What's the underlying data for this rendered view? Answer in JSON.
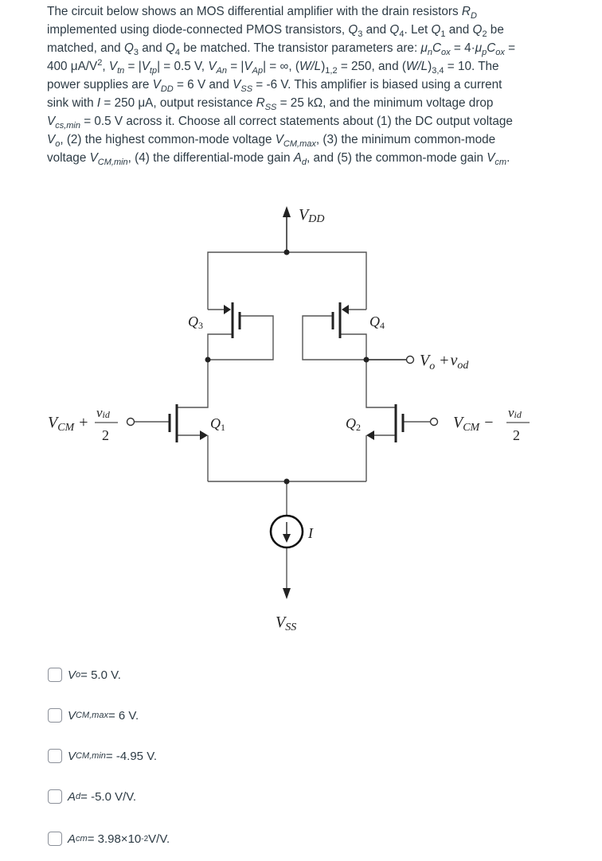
{
  "question": {
    "p1": "The circuit below shows an MOS differential amplifier with the drain resistors ",
    "RD": "R",
    "RD_sub": "D",
    "p2": " implemented using diode-connected PMOS transistors, ",
    "Q3": "Q",
    "Q3_sub": "3",
    "and": " and ",
    "Q4": "Q",
    "Q4_sub": "4",
    "p3": ". Let ",
    "Q1": "Q",
    "Q1_sub": "1",
    "Q2": "Q",
    "Q2_sub": "2",
    "p4": " be matched, and ",
    "p5": " be matched. The transistor parameters are: ",
    "mun": "μ",
    "mun_sub": "n",
    "Cox": "C",
    "Cox_sub": "ox",
    "p6": " = 4·",
    "mup": "μ",
    "mup_sub": "p",
    "p7": " = 400 μA/V",
    "sq": "2",
    "p8": ", ",
    "Vtn": "V",
    "Vtn_sub": "tn",
    "p9": " = |",
    "Vtp": "V",
    "Vtp_sub": "tp",
    "p10": "| = 0.5 V, ",
    "VAn": "V",
    "VAn_sub": "An",
    "VAp": "V",
    "VAp_sub": "Ap",
    "p11": "| = ∞, (",
    "WL": "W/L",
    "WL12_sub": "1,2",
    "p12": ") ",
    "p13": " = 250, and (",
    "WL34_sub": "3,4",
    "p14": " = 10. The power supplies are ",
    "VDD": "V",
    "VDD_sub": "DD",
    "p15": " = 6 V and ",
    "VSS": "V",
    "VSS_sub": "SS",
    "p16": " = -6 V. This amplifier is biased using a current sink with ",
    "I": "I",
    "p17": " = 250 μA, output resistance ",
    "RSS": "R",
    "RSS_sub": "SS",
    "p18": " = 25 kΩ, and the minimum voltage drop ",
    "Vcs": "V",
    "Vcs_sub": "cs,min",
    "p19": " = 0.5 V across it. Choose all correct statements about (1) the DC output voltage ",
    "Vo": "V",
    "Vo_sub": "o",
    "p20": ", (2) the highest common-mode voltage ",
    "VCMmax": "V",
    "VCMmax_sub": "CM,max",
    "p21": ", (3) the minimum common-mode voltage ",
    "VCMmin": "V",
    "VCMmin_sub": "CM,min",
    "p22": ", (4) the differential-mode gain ",
    "Ad": "A",
    "Ad_sub": "d",
    "p23": ", and (5) the common-mode gain ",
    "Vcm": "V",
    "Vcm_sub": "cm",
    "p24": "."
  },
  "circuit": {
    "vdd_label": "V",
    "vdd_sub": "DD",
    "vss_label": "V",
    "vss_sub": "SS",
    "q3_label": "Q",
    "q3_sub": "3",
    "q4_label": "Q",
    "q4_sub": "4",
    "q1_label": "Q",
    "q1_sub": "1",
    "q2_label": "Q",
    "q2_sub": "2",
    "current_label": "I",
    "out_V": "V",
    "out_o": "o",
    "out_plus": "+",
    "out_v": "v",
    "out_od": "od",
    "in_left_V": "V",
    "in_left_CM": "CM",
    "in_left_sign": "+",
    "in_right_V": "V",
    "in_right_CM": "CM",
    "in_right_sign": "−",
    "vid_v": "v",
    "vid_sub": "id",
    "vid_den": "2"
  },
  "options": [
    {
      "var": "V",
      "sub": "o",
      "text": " = 5.0 V.",
      "checked": false
    },
    {
      "var": "V",
      "sub": "CM,max",
      "text": " = 6 V.",
      "checked": false
    },
    {
      "var": "V",
      "sub": "CM,min",
      "text": " = -4.95 V.",
      "checked": false
    },
    {
      "var": "A",
      "sub": "d",
      "text": " = -5.0 V/V.",
      "checked": false
    },
    {
      "var": "A",
      "sub": "cm",
      "text": " = 3.98×10",
      "sup": "-2",
      "text2": " V/V.",
      "checked": false
    }
  ]
}
